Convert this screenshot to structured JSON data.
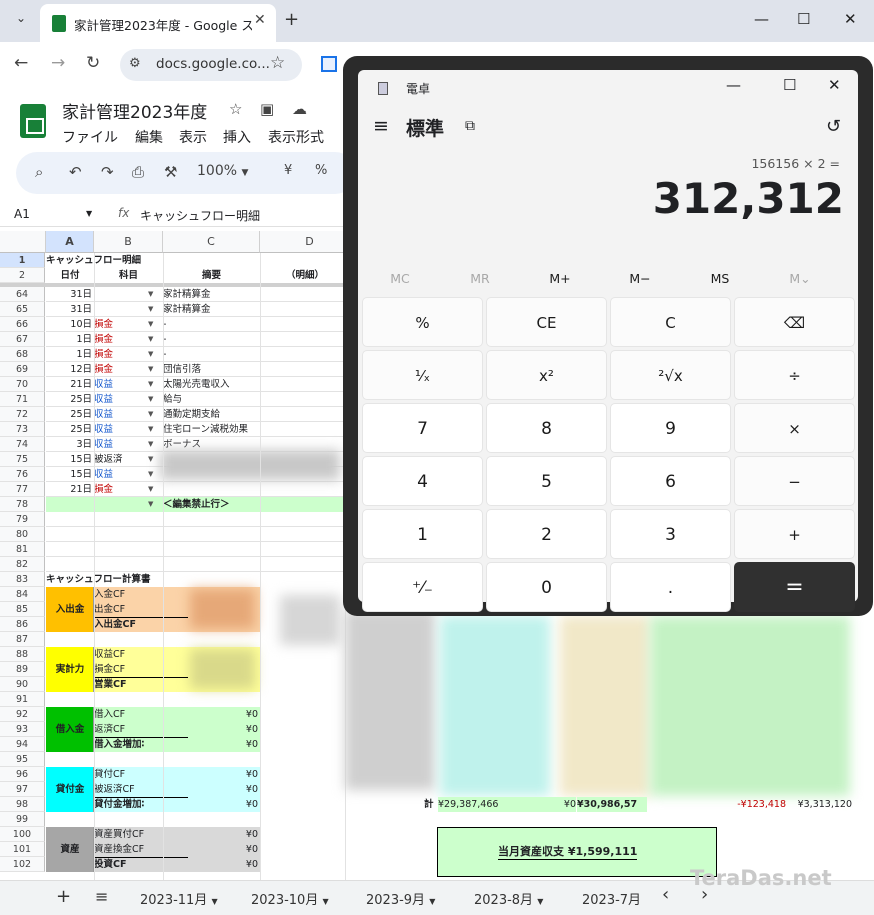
{
  "browser": {
    "tab_title": "家計管理2023年度 - Google スプ",
    "url": "docs.google.co...",
    "minimize": "—",
    "maximize": "☐",
    "close": "✕"
  },
  "sheets": {
    "doc_title": "家計管理2023年度",
    "menus": [
      "ファイル",
      "編集",
      "表示",
      "挿入",
      "表示形式"
    ],
    "zoom": "100%",
    "currency": "¥",
    "percent": "%",
    "cell_ref": "A1",
    "fx": "fx",
    "formula": "キャッシュフロー明細",
    "col_headers": [
      "A",
      "B",
      "C",
      "D"
    ],
    "header_rows": [
      {
        "num": "1",
        "a": "キャッシュフロー明細"
      },
      {
        "num": "2",
        "a": "日付",
        "b": "科目",
        "c": "摘要",
        "d": "（明細）"
      }
    ],
    "rows": [
      {
        "num": "64",
        "a": "31日",
        "b": "",
        "c": "家計精算金",
        "bc": ""
      },
      {
        "num": "65",
        "a": "31日",
        "b": "",
        "c": "家計精算金",
        "bc": ""
      },
      {
        "num": "66",
        "a": "10日",
        "b": "損金",
        "c": "-",
        "bc": "red"
      },
      {
        "num": "67",
        "a": "1日",
        "b": "損金",
        "c": "-",
        "bc": "red"
      },
      {
        "num": "68",
        "a": "1日",
        "b": "損金",
        "c": "-",
        "bc": "red"
      },
      {
        "num": "69",
        "a": "12日",
        "b": "損金",
        "c": "団信引落",
        "bc": "red"
      },
      {
        "num": "70",
        "a": "21日",
        "b": "収益",
        "c": "太陽光売電収入",
        "bc": "blue"
      },
      {
        "num": "71",
        "a": "25日",
        "b": "収益",
        "c": "給与",
        "bc": "blue"
      },
      {
        "num": "72",
        "a": "25日",
        "b": "収益",
        "c": "通勤定期支給",
        "bc": "blue"
      },
      {
        "num": "73",
        "a": "25日",
        "b": "収益",
        "c": "住宅ローン減税効果",
        "bc": "blue"
      },
      {
        "num": "74",
        "a": "3日",
        "b": "収益",
        "c": "ボーナス",
        "bc": "blue"
      },
      {
        "num": "75",
        "a": "15日",
        "b": "被返済",
        "c": "",
        "bc": ""
      },
      {
        "num": "76",
        "a": "15日",
        "b": "収益",
        "c": "",
        "bc": "blue"
      },
      {
        "num": "77",
        "a": "21日",
        "b": "損金",
        "c": "",
        "bc": "red"
      }
    ],
    "row78_text": "＜編集禁止行＞",
    "empty_rows": [
      "79",
      "80",
      "81",
      "82"
    ],
    "row83_text": "キャッシュフロー計算書",
    "groups": [
      {
        "label": "入出金",
        "color": "#ffc000",
        "fill": "#fbd3a8",
        "rows": [
          {
            "num": "84",
            "b": "入金CF",
            "v": ""
          },
          {
            "num": "85",
            "b": "出金CF",
            "v": ""
          },
          {
            "num": "86",
            "b": "入出金CF",
            "v": ""
          }
        ]
      },
      {
        "label": "実計力",
        "color": "#ffff00",
        "fill": "#ffff99",
        "rows": [
          {
            "num": "88",
            "b": "収益CF",
            "v": ""
          },
          {
            "num": "89",
            "b": "損金CF",
            "v": ""
          },
          {
            "num": "90",
            "b": "営業CF",
            "v": ""
          }
        ]
      },
      {
        "label": "借入金",
        "color": "#00c000",
        "fill": "#ccffcc",
        "rows": [
          {
            "num": "92",
            "b": "借入CF",
            "v": "¥0"
          },
          {
            "num": "93",
            "b": "返済CF",
            "v": "¥0"
          },
          {
            "num": "94",
            "b": "借入金増加∶",
            "v": "¥0"
          }
        ]
      },
      {
        "label": "貸付金",
        "color": "#00ffff",
        "fill": "#ccffff",
        "rows": [
          {
            "num": "96",
            "b": "貸付CF",
            "v": "¥0"
          },
          {
            "num": "97",
            "b": "被返済CF",
            "v": "¥0"
          },
          {
            "num": "98",
            "b": "貸付金増加∶",
            "v": "¥0"
          }
        ]
      },
      {
        "label": "資産",
        "color": "#a6a6a6",
        "fill": "#d9d9d9",
        "rows": [
          {
            "num": "100",
            "b": "資産買付CF",
            "v": "¥0"
          },
          {
            "num": "101",
            "b": "資産換金CF",
            "v": "¥0"
          },
          {
            "num": "102",
            "b": "投資CF",
            "v": "¥0"
          }
        ]
      }
    ],
    "gap_rows": [
      "87",
      "91",
      "95",
      "99"
    ],
    "totals_row": {
      "label": "計",
      "v1": "¥29,387,466",
      "v2": "¥0",
      "v3": "¥30,986,57",
      "v4": "-¥123,418",
      "v5": "¥3,313,120"
    },
    "summary_box": "当月資産収支 ¥1,599,111",
    "sheet_tabs": [
      "2023-11月",
      "2023-10月",
      "2023-9月",
      "2023-8月",
      "2023-7月"
    ],
    "add_sheet": "+",
    "all_sheets": "≡",
    "prev": "‹",
    "next": "›"
  },
  "calculator": {
    "app_title": "電卓",
    "mode": "標準",
    "expression": "156156 × 2 =",
    "display": "312,312",
    "memory": [
      "MC",
      "MR",
      "M+",
      "M−",
      "MS",
      "M⌄"
    ],
    "memory_disabled": [
      true,
      true,
      false,
      false,
      false,
      true
    ],
    "keys": [
      [
        "%",
        "CE",
        "C",
        "⌫"
      ],
      [
        "¹⁄ₓ",
        "x²",
        "²√x",
        "÷"
      ],
      [
        "7",
        "8",
        "9",
        "×"
      ],
      [
        "4",
        "5",
        "6",
        "−"
      ],
      [
        "1",
        "2",
        "3",
        "+"
      ],
      [
        "⁺⁄₋",
        "0",
        ".",
        "="
      ]
    ],
    "key_names": [
      [
        "percent-key",
        "clear-entry-key",
        "clear-key",
        "backspace-key"
      ],
      [
        "reciprocal-key",
        "square-key",
        "sqrt-key",
        "divide-key"
      ],
      [
        "digit-7-key",
        "digit-8-key",
        "digit-9-key",
        "multiply-key"
      ],
      [
        "digit-4-key",
        "digit-5-key",
        "digit-6-key",
        "minus-key"
      ],
      [
        "digit-1-key",
        "digit-2-key",
        "digit-3-key",
        "plus-key"
      ],
      [
        "negate-key",
        "digit-0-key",
        "decimal-key",
        "equals-key"
      ]
    ]
  },
  "watermark": "TeraDas.net"
}
